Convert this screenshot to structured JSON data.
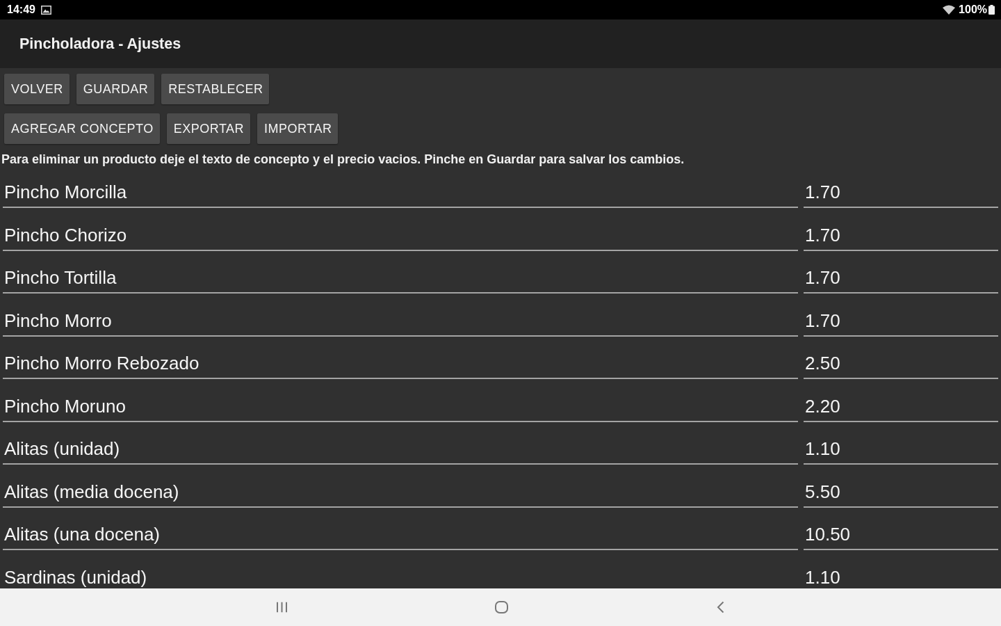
{
  "status_bar": {
    "time": "14:49",
    "battery": "100%"
  },
  "app_bar": {
    "title": "Pincholadora - Ajustes"
  },
  "button_rows": [
    [
      "VOLVER",
      "GUARDAR",
      "RESTABLECER"
    ],
    [
      "AGREGAR CONCEPTO",
      "EXPORTAR",
      "IMPORTAR"
    ]
  ],
  "hint": "Para eliminar un producto deje el texto de concepto y el precio vacios. Pinche en Guardar para salvar los cambios.",
  "items": [
    {
      "concept": "Pincho Morcilla",
      "price": "1.70"
    },
    {
      "concept": "Pincho Chorizo",
      "price": "1.70"
    },
    {
      "concept": "Pincho Tortilla",
      "price": "1.70"
    },
    {
      "concept": "Pincho Morro",
      "price": "1.70"
    },
    {
      "concept": "Pincho Morro Rebozado",
      "price": "2.50"
    },
    {
      "concept": "Pincho Moruno",
      "price": "2.20"
    },
    {
      "concept": "Alitas (unidad)",
      "price": "1.10"
    },
    {
      "concept": "Alitas (media docena)",
      "price": "5.50"
    },
    {
      "concept": "Alitas (una docena)",
      "price": "10.50"
    },
    {
      "concept": "Sardinas (unidad)",
      "price": "1.10"
    }
  ]
}
